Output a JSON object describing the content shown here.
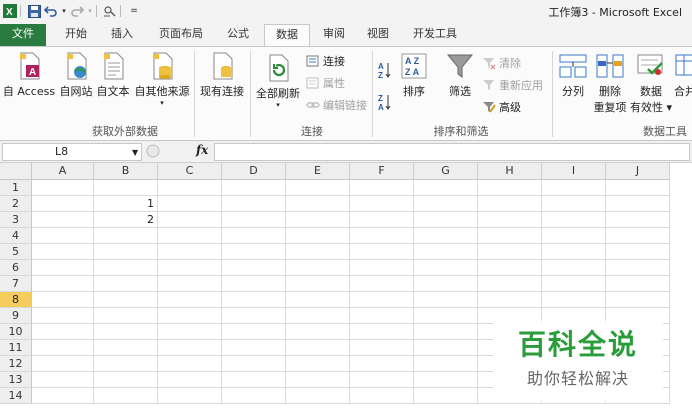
{
  "window": {
    "title": "工作簿3 - Microsoft Excel"
  },
  "quick_access": {
    "icons": [
      "excel-logo-icon",
      "save-icon",
      "undo-icon",
      "redo-icon",
      "customize-icon"
    ]
  },
  "tabs": [
    {
      "label": "文件"
    },
    {
      "label": "开始"
    },
    {
      "label": "插入"
    },
    {
      "label": "页面布局"
    },
    {
      "label": "公式"
    },
    {
      "label": "数据"
    },
    {
      "label": "审阅"
    },
    {
      "label": "视图"
    },
    {
      "label": "开发工具"
    }
  ],
  "ribbon": {
    "external": {
      "access": "自 Access",
      "web": "自网站",
      "text": "自文本",
      "other": "自其他来源",
      "existing": "现有连接",
      "group": "获取外部数据"
    },
    "connections": {
      "refresh_all": "全部刷新",
      "connections": "连接",
      "properties": "属性",
      "edit_links": "编辑链接",
      "group": "连接"
    },
    "sort_filter": {
      "sort": "排序",
      "filter": "筛选",
      "clear": "清除",
      "reapply": "重新应用",
      "advanced": "高级",
      "group": "排序和筛选"
    },
    "data_tools": {
      "split": "分列",
      "remove_dup_1": "删除",
      "remove_dup_2": "重复项",
      "validation_1": "数据",
      "validation_2": "有效性",
      "consolidate": "合并",
      "group": "数据工具"
    }
  },
  "formula_bar": {
    "name_box": "L8",
    "fx": "fx",
    "value": ""
  },
  "grid": {
    "columns": [
      "A",
      "B",
      "C",
      "D",
      "E",
      "F",
      "G",
      "H",
      "I",
      "J"
    ],
    "rows": [
      "1",
      "2",
      "3",
      "4",
      "5",
      "6",
      "7",
      "8",
      "9",
      "10",
      "11",
      "12",
      "13",
      "14"
    ],
    "selected_row": "8",
    "cells": {
      "B2": "1",
      "B3": "2"
    }
  },
  "watermark": {
    "title": "百科全说",
    "subtitle": "助你轻松解决"
  },
  "colors": {
    "file_tab": "#2a7b3f",
    "selected_row": "#f6cc5c",
    "watermark_green": "#2a9d3a"
  }
}
